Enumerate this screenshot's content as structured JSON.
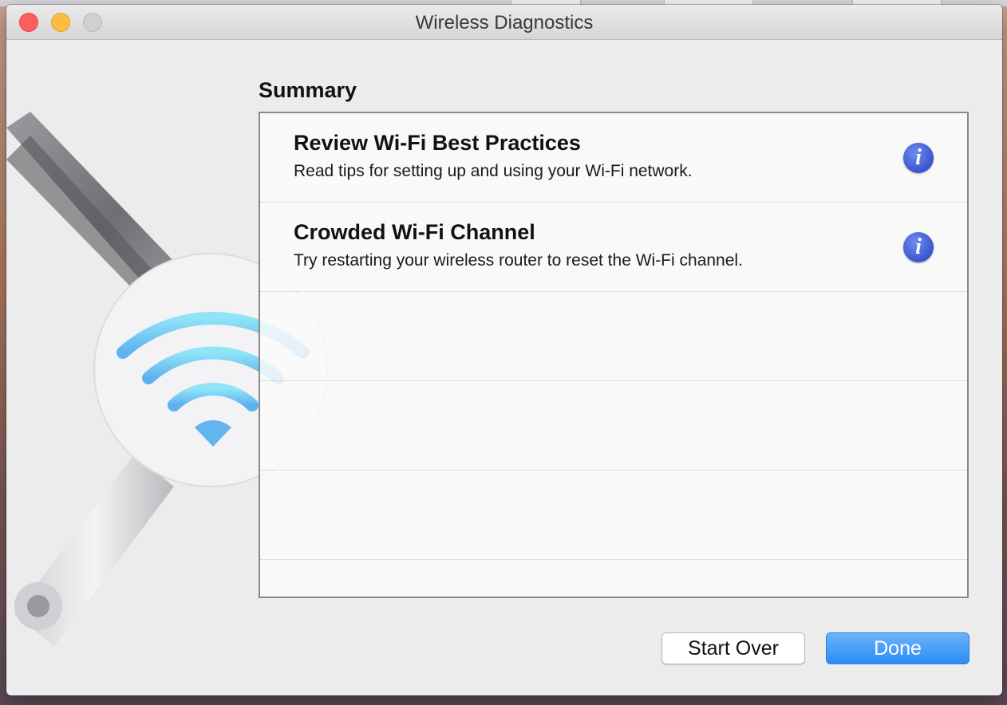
{
  "window": {
    "title": "Wireless Diagnostics"
  },
  "summary": {
    "heading": "Summary",
    "items": [
      {
        "title": "Review Wi-Fi Best Practices",
        "description": "Read tips for setting up and using your Wi-Fi network.",
        "icon": "info-icon"
      },
      {
        "title": "Crowded Wi-Fi Channel",
        "description": "Try restarting your wireless router to reset the Wi-Fi channel.",
        "icon": "info-icon"
      }
    ]
  },
  "buttons": {
    "start_over": "Start Over",
    "done": "Done"
  },
  "colors": {
    "accent": "#2a8cf7",
    "info_icon": "#3a55cf",
    "close": "#fc605c",
    "minimize": "#fdbc40",
    "zoom_disabled": "#d0d0d0"
  }
}
